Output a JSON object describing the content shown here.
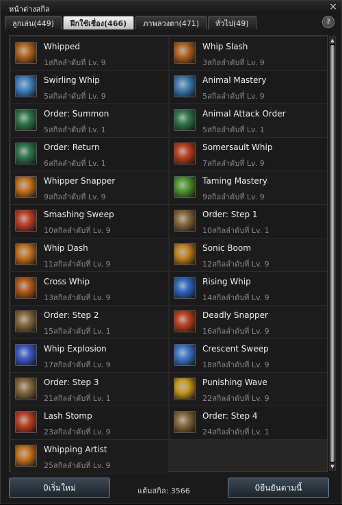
{
  "window": {
    "title": "หน้าต่างสกิล",
    "close_glyph": "×"
  },
  "tabs": [
    {
      "label": "ลูกเล่น(449)",
      "active": false
    },
    {
      "label": "ฝึกใช้เชื่อง(466)",
      "active": true
    },
    {
      "label": "ภาพลวงตา(471)",
      "active": false
    },
    {
      "label": "ทั่วไป(49)",
      "active": false
    }
  ],
  "help_glyph": "?",
  "skills_left": [
    {
      "name": "Whipped",
      "level": "1สกิลลำดับที่ Lv. 9",
      "icon": "whip-coil-icon",
      "color": "#b8651e"
    },
    {
      "name": "Swirling Whip",
      "level": "5สกิลลำดับที่ Lv. 9",
      "icon": "tornado-icon",
      "color": "#3f86c9"
    },
    {
      "name": "Order: Summon",
      "level": "5สกิลลำดับที่ Lv. 1",
      "icon": "whistle-icon",
      "color": "#2e7a4a"
    },
    {
      "name": "Order: Return",
      "level": "6สกิลลำดับที่ Lv. 1",
      "icon": "whistle-icon",
      "color": "#2e7a4a"
    },
    {
      "name": "Whipper Snapper",
      "level": "9สกิลลำดับที่ Lv. 9",
      "icon": "slash-icon",
      "color": "#c9741a"
    },
    {
      "name": "Smashing Sweep",
      "level": "10สกิลลำดับที่ Lv. 9",
      "icon": "sweep-icon",
      "color": "#c4401f"
    },
    {
      "name": "Whip Dash",
      "level": "11สกิลลำดับที่ Lv. 9",
      "icon": "dash-icon",
      "color": "#c9741a"
    },
    {
      "name": "Cross Whip",
      "level": "13สกิลลำดับที่ Lv. 9",
      "icon": "cross-icon",
      "color": "#b85a14"
    },
    {
      "name": "Order: Step 2",
      "level": "15สกิลลำดับที่ Lv. 1",
      "icon": "cannon-icon",
      "color": "#8a6a3a"
    },
    {
      "name": "Whip Explosion",
      "level": "17สกิลลำดับที่ Lv. 9",
      "icon": "explosion-icon",
      "color": "#3a5ad0"
    },
    {
      "name": "Order: Step 3",
      "level": "21สกิลลำดับที่ Lv. 1",
      "icon": "cannon-icon",
      "color": "#8a6a3a"
    },
    {
      "name": "Lash Stomp",
      "level": "23สกิลลำดับที่ Lv. 9",
      "icon": "lash-icon",
      "color": "#c4401f"
    },
    {
      "name": "Whipping Artist",
      "level": "25สกิลลำดับที่ Lv. 9",
      "icon": "spiral-icon",
      "color": "#c9741a"
    }
  ],
  "skills_right": [
    {
      "name": "Whip Slash",
      "level": "3สกิลลำดับที่ Lv. 9",
      "icon": "whip-coil-icon",
      "color": "#b8651e"
    },
    {
      "name": "Animal Mastery",
      "level": "5สกิลลำดับที่ Lv. 9",
      "icon": "brain-icon",
      "color": "#3f7fb8"
    },
    {
      "name": "Animal Attack Order",
      "level": "5สกิลลำดับที่ Lv. 1",
      "icon": "whistle-icon",
      "color": "#2e7a4a"
    },
    {
      "name": "Somersault Whip",
      "level": "7สกิลลำดับที่ Lv. 9",
      "icon": "flip-icon",
      "color": "#c4401f"
    },
    {
      "name": "Taming Mastery",
      "level": "9สกิลลำดับที่ Lv. 9",
      "icon": "arrows-up-icon",
      "color": "#4f9a2a"
    },
    {
      "name": "Order: Step 1",
      "level": "10สกิลลำดับที่ Lv. 1",
      "icon": "cannon-icon",
      "color": "#8a6a3a"
    },
    {
      "name": "Sonic Boom",
      "level": "12สกิลลำดับที่ Lv. 9",
      "icon": "boom-icon",
      "color": "#c9841a"
    },
    {
      "name": "Rising Whip",
      "level": "14สกิลลำดับที่ Lv. 9",
      "icon": "arc-icon",
      "color": "#2a6ac9"
    },
    {
      "name": "Deadly Snapper",
      "level": "16สกิลลำดับที่ Lv. 9",
      "icon": "snap-icon",
      "color": "#c4401f"
    },
    {
      "name": "Crescent Sweep",
      "level": "18สกิลลำดับที่ Lv. 9",
      "icon": "crescent-icon",
      "color": "#3a7ad0"
    },
    {
      "name": "Punishing Wave",
      "level": "22สกิลลำดับที่ Lv. 9",
      "icon": "wave-icon",
      "color": "#d09a1a"
    },
    {
      "name": "Order: Step 4",
      "level": "24สกิลลำดับที่ Lv. 1",
      "icon": "cannon-icon",
      "color": "#8a6a3a"
    }
  ],
  "footer": {
    "reset_label": "0เริ่มใหม่",
    "points_label": "แต้มสกิล: 3566",
    "confirm_label": "0ยืนยันตามนี้"
  }
}
